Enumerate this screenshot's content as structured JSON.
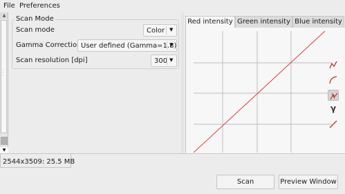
{
  "menu": {
    "file": "File",
    "preferences": "Preferences"
  },
  "scan_mode_group": {
    "title": "Scan Mode",
    "mode": {
      "label": "Scan mode",
      "value": "Color"
    },
    "gamma": {
      "label": "Gamma Correction",
      "value": "User defined (Gamma=1.8)"
    },
    "resolution": {
      "label": "Scan resolution [dpi]",
      "value": "300"
    }
  },
  "tabs": [
    {
      "label": "Red intensity",
      "selected": true
    },
    {
      "label": "Green intensity",
      "selected": false
    },
    {
      "label": "Blue intensity",
      "selected": false
    }
  ],
  "curve": {
    "color": "#e03a3a",
    "grid_color": "#bdbdbd",
    "shape": "linear"
  },
  "curve_tools": [
    {
      "icon": "freehand-curve-icon"
    },
    {
      "icon": "spline-curve-icon"
    },
    {
      "icon": "linear-curve-icon",
      "active": true
    },
    {
      "icon": "gamma-icon",
      "symbol": "γ"
    },
    {
      "icon": "reset-curve-icon"
    }
  ],
  "status": {
    "text": "2544x3509: 25.5 MB"
  },
  "buttons": {
    "scan": "Scan",
    "preview": "Preview Window"
  },
  "colors": {
    "background": "#ececec",
    "curve_red": "#e03a3a"
  }
}
